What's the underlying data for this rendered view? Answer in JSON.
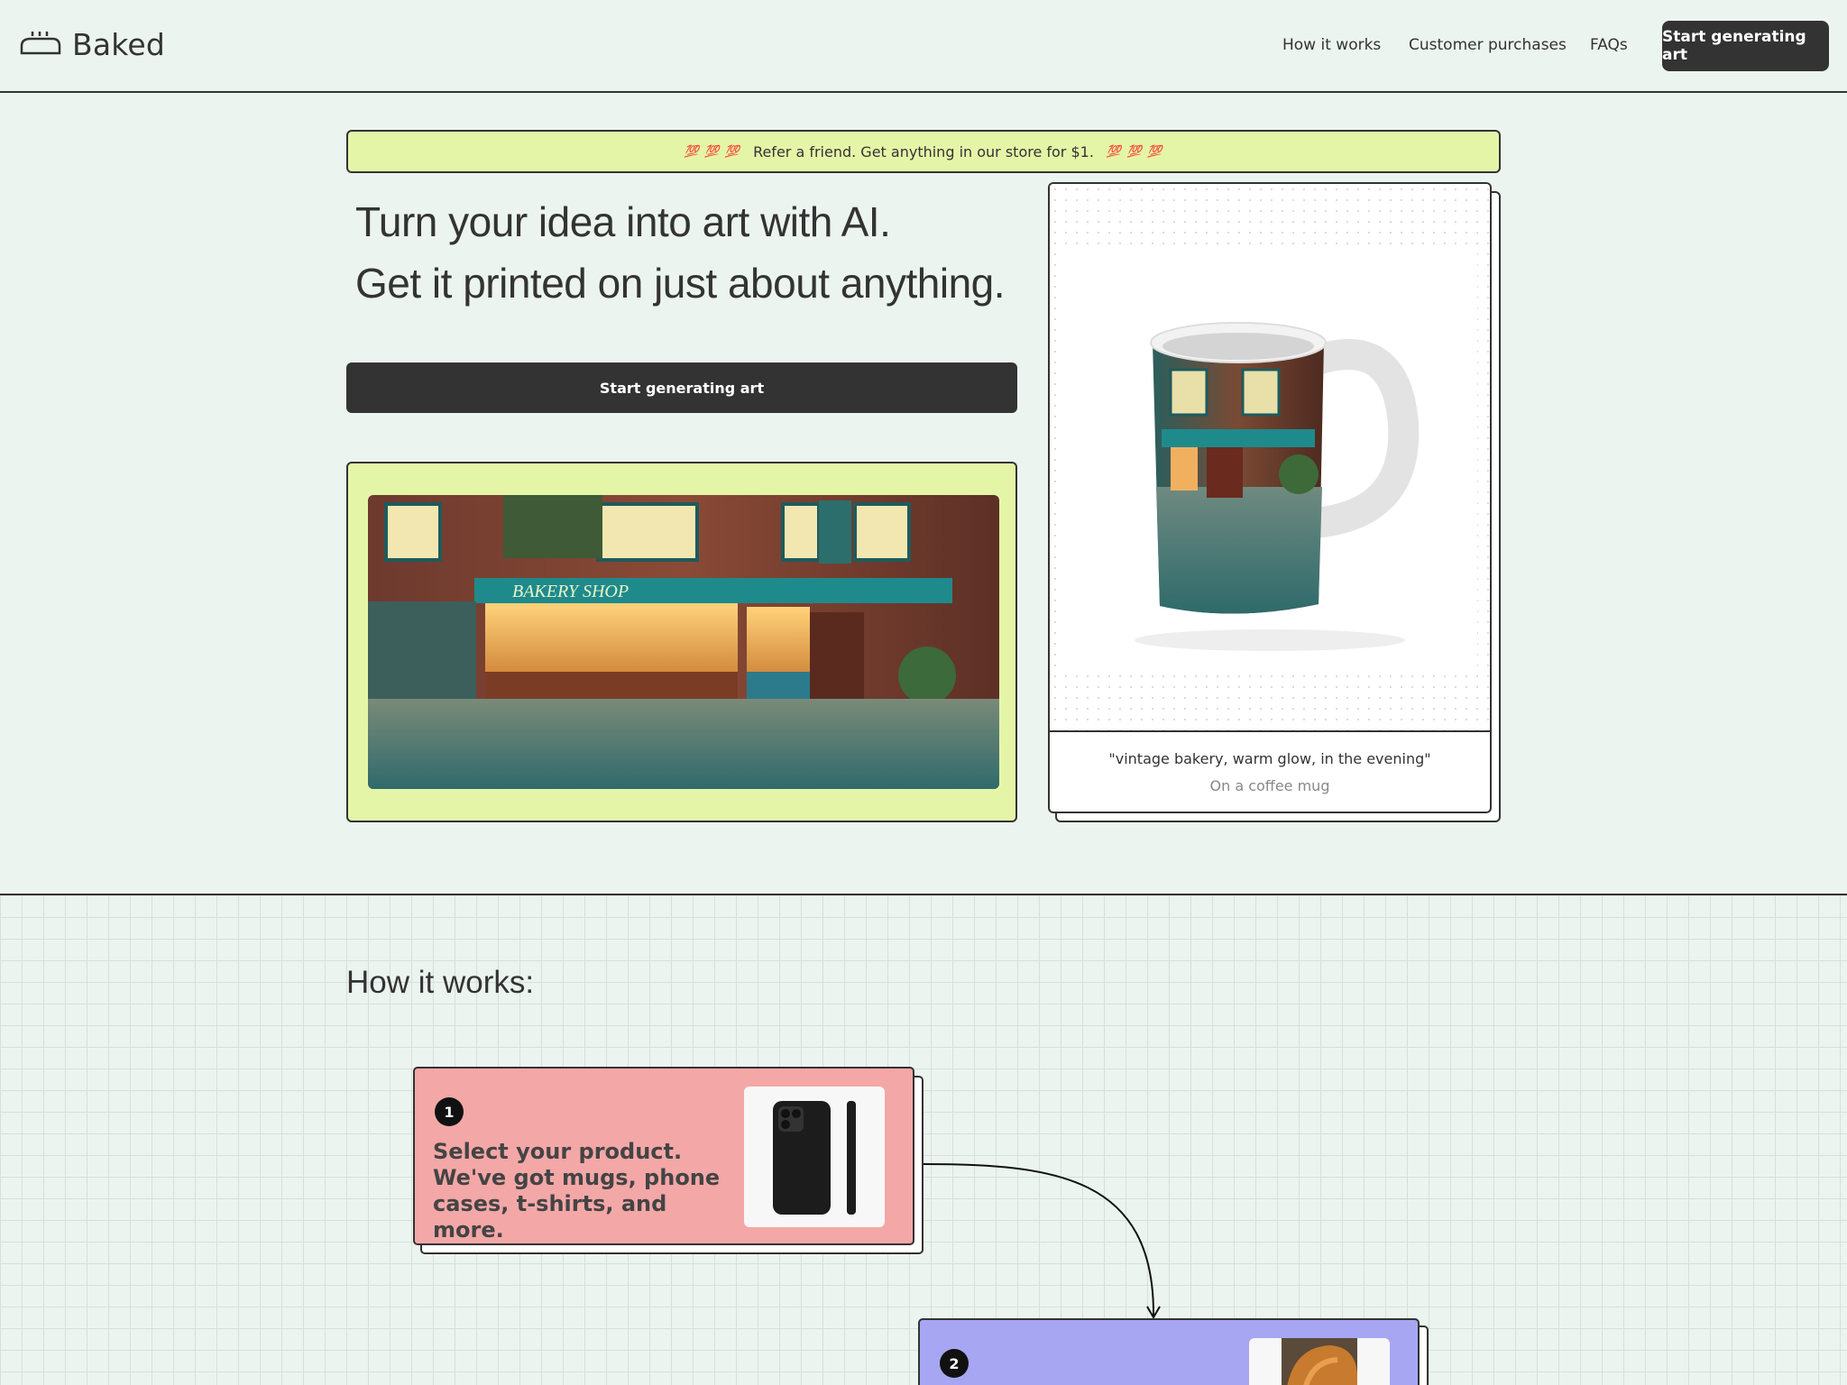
{
  "header": {
    "brand": "Baked",
    "nav": [
      "How it works",
      "Customer purchases",
      "FAQs"
    ],
    "cta": "Start generating art"
  },
  "promo": {
    "emoji_left": "💯 💯 💯",
    "text": "Refer a friend. Get anything in our store for $1.",
    "emoji_right": "💯 💯 💯"
  },
  "hero": {
    "title_line1": "Turn your idea into art with AI.",
    "title_line2": "Get it printed on just about anything.",
    "cta": "Start generating art"
  },
  "showcase": {
    "prompt": "\"vintage bakery, warm glow, in the evening\"",
    "product": "On a coffee mug"
  },
  "how_it_works": {
    "title": "How it works:",
    "steps": [
      {
        "number": "1",
        "text": "Select your product. We've got mugs, phone cases, t-shirts, and more."
      },
      {
        "number": "2",
        "text": ""
      }
    ]
  },
  "colors": {
    "background": "#ecf4f0",
    "ink": "#333333",
    "lime": "#e5f5a8",
    "step1": "#f4a7a7",
    "step2": "#a7a6f2"
  }
}
